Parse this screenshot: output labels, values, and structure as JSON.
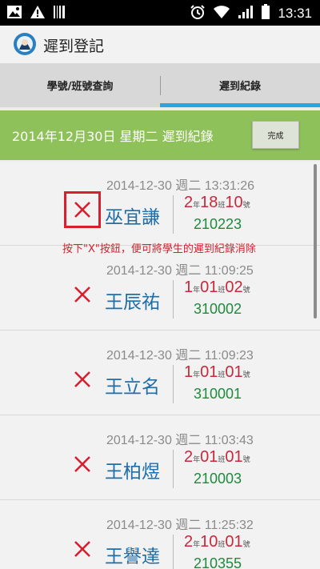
{
  "status_bar": {
    "time": "13:31",
    "left_icons": [
      "image-icon",
      "warning-icon",
      "barcode-icon"
    ],
    "right_icons": [
      "alarm-icon",
      "wifi-icon",
      "signal-icon",
      "battery-icon"
    ]
  },
  "app": {
    "title": "遲到登記",
    "icon": "app-logo-icon"
  },
  "tabs": [
    {
      "label": "學號/班號查詢",
      "active": false
    },
    {
      "label": "遲到紀錄",
      "active": true
    }
  ],
  "header": {
    "title": "2014年12月30日 星期二 遲到紀錄",
    "done_label": "完成",
    "color": "#8ec15a"
  },
  "annotation": "按下\"X\"按鈕，便可將學生的遲到紀錄消除",
  "units": {
    "grade": "年",
    "class": "班",
    "number": "號"
  },
  "records": [
    {
      "timestamp": "2014-12-30 週二 13:31:26",
      "name": "巫宜謙",
      "grade": "2",
      "class": "18",
      "number": "10",
      "student_id": "210223",
      "highlighted": true
    },
    {
      "timestamp": "2014-12-30 週二 11:09:25",
      "name": "王辰祐",
      "grade": "1",
      "class": "01",
      "number": "02",
      "student_id": "310002",
      "highlighted": false
    },
    {
      "timestamp": "2014-12-30 週二 11:09:23",
      "name": "王立名",
      "grade": "1",
      "class": "01",
      "number": "01",
      "student_id": "310001",
      "highlighted": false
    },
    {
      "timestamp": "2014-12-30 週二 11:03:43",
      "name": "王柏煜",
      "grade": "2",
      "class": "01",
      "number": "01",
      "student_id": "210003",
      "highlighted": false
    },
    {
      "timestamp": "2014-12-30 週二 11:25:32",
      "name": "王譽達",
      "grade": "2",
      "class": "10",
      "number": "01",
      "student_id": "210355",
      "highlighted": false
    }
  ],
  "colors": {
    "accent": "#2aa4dc",
    "delete": "#d62030",
    "name": "#1f6ea8",
    "student_id": "#1e8a3c"
  }
}
